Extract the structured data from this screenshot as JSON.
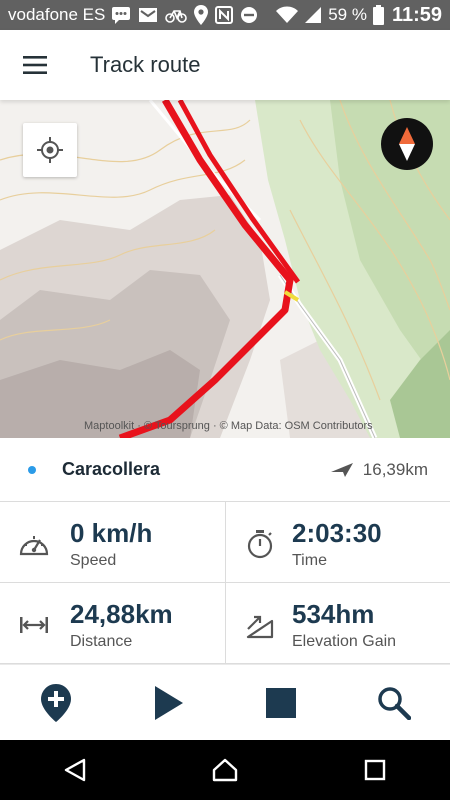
{
  "status_bar": {
    "carrier": "vodafone ES",
    "battery_percent": "59 %",
    "time": "11:59",
    "icons": [
      "message-icon",
      "mail-icon",
      "bike-icon",
      "location-icon",
      "nfc-icon",
      "do-not-disturb-icon",
      "wifi-icon",
      "signal-icon",
      "battery-icon"
    ]
  },
  "app_bar": {
    "menu_icon": "hamburger-menu-icon",
    "title": "Track route"
  },
  "map": {
    "attribution": "Maptoolkit · © Toursprung · © Map Data: OSM Contributors",
    "route_color": "#e8121c",
    "locate_icon": "my-location-icon",
    "compass_icon": "compass-icon"
  },
  "route": {
    "name": "Caracollera",
    "distance": "16,39km",
    "dot_color": "#2b9be8",
    "direction_icon": "navigation-arrow-icon"
  },
  "stats": [
    {
      "value": "0 km/h",
      "label": "Speed",
      "icon": "speedometer-icon"
    },
    {
      "value": "2:03:30",
      "label": "Time",
      "icon": "stopwatch-icon"
    },
    {
      "value": "24,88km",
      "label": "Distance",
      "icon": "distance-icon"
    },
    {
      "value": "534hm",
      "label": "Elevation Gain",
      "icon": "elevation-icon"
    }
  ],
  "actions": [
    {
      "name": "add-marker",
      "icon": "add-location-icon"
    },
    {
      "name": "play",
      "icon": "play-icon"
    },
    {
      "name": "stop",
      "icon": "stop-icon"
    },
    {
      "name": "search",
      "icon": "search-icon"
    }
  ],
  "nav_bar": [
    "back-icon",
    "home-icon",
    "recents-icon"
  ],
  "colors": {
    "accent_dark": "#1d3a50",
    "status_bar": "#616161",
    "route_red": "#e8121c"
  }
}
